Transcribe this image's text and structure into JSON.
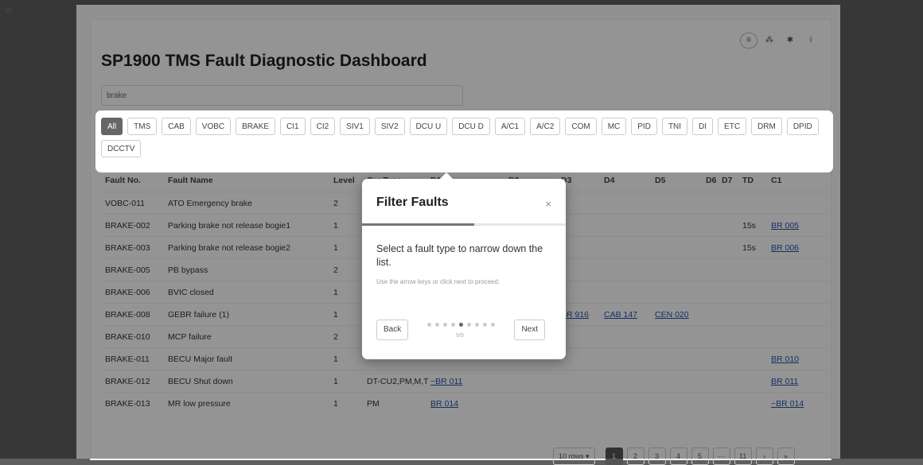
{
  "app": {
    "title": "SP1900 TMS Fault Diagnostic Dashboard",
    "search_value": "brake"
  },
  "toolbar_icons": [
    {
      "name": "list-view-icon",
      "glyph": "≡"
    },
    {
      "name": "hierarchy-icon",
      "glyph": "⁂"
    },
    {
      "name": "settings-icon",
      "glyph": "✱"
    },
    {
      "name": "info-icon",
      "glyph": "i"
    }
  ],
  "filters": [
    "All",
    "TMS",
    "CAB",
    "VOBC",
    "BRAKE",
    "CI1",
    "CI2",
    "SIV1",
    "SIV2",
    "DCU U",
    "DCU D",
    "A/C1",
    "A/C2",
    "COM",
    "MC",
    "PID",
    "TNI",
    "DI",
    "ETC",
    "DRM",
    "DPID",
    "DCCTV"
  ],
  "active_filter": "All",
  "table": {
    "headers": {
      "no": "Fault No.",
      "name": "Fault Name",
      "level": "Level",
      "car": "Car Type",
      "d1": "D1",
      "d2": "D2",
      "d3": "D3",
      "d4": "D4",
      "d5": "D5",
      "d6": "D6",
      "d7": "D7",
      "td": "TD",
      "c1": "C1"
    },
    "rows": [
      {
        "no": "VOBC-011",
        "name": "ATO Emergency brake",
        "level": "2",
        "car": "",
        "d1": "",
        "d2": "",
        "d3": "",
        "d4": "",
        "d5": "",
        "td": "",
        "c1": ""
      },
      {
        "no": "BRAKE-002",
        "name": "Parking brake not release bogie1",
        "level": "1",
        "car": "",
        "d1": "",
        "d2": "",
        "d3": "",
        "d4": "",
        "d5": "",
        "td": "15s",
        "c1": "BR 005"
      },
      {
        "no": "BRAKE-003",
        "name": "Parking brake not release bogie2",
        "level": "1",
        "car": "",
        "d1": "",
        "d2": "",
        "d3": "",
        "d4": "",
        "d5": "",
        "td": "15s",
        "c1": "BR 006"
      },
      {
        "no": "BRAKE-005",
        "name": "PB bypass",
        "level": "2",
        "car": "",
        "d1": "",
        "d2": "",
        "d3": "",
        "d4": "",
        "d5": "",
        "td": "",
        "c1": ""
      },
      {
        "no": "BRAKE-006",
        "name": "BVIC closed",
        "level": "1",
        "car": "",
        "d1": "",
        "d2": "",
        "d3": "",
        "d4": "",
        "d5": "",
        "td": "",
        "c1": ""
      },
      {
        "no": "BRAKE-008",
        "name": "GEBR failure (1)",
        "level": "1",
        "car": "",
        "d1": "",
        "d2": "",
        "d3": "BR 916",
        "d4": "CAB 147",
        "d5": "CEN 020",
        "td": "",
        "c1": ""
      },
      {
        "no": "BRAKE-010",
        "name": "MCP failure",
        "level": "2",
        "car": "",
        "d1": "",
        "d2": "",
        "d3": "",
        "d4": "",
        "d5": "",
        "td": "",
        "c1": ""
      },
      {
        "no": "BRAKE-011",
        "name": "BECU Major fault",
        "level": "1",
        "car": "",
        "d1": "",
        "d2": "",
        "d3": "",
        "d4": "",
        "d5": "",
        "td": "",
        "c1": "BR 010"
      },
      {
        "no": "BRAKE-012",
        "name": "BECU Shut down",
        "level": "1",
        "car": "DT-CU2,PM,M,T",
        "d1": "~BR 011",
        "d2": "",
        "d3": "",
        "d4": "",
        "d5": "",
        "td": "",
        "c1": "BR 011"
      },
      {
        "no": "BRAKE-013",
        "name": "MR low pressure",
        "level": "1",
        "car": "PM",
        "d1": "BR 014",
        "d2": "",
        "d3": "",
        "d4": "",
        "d5": "",
        "td": "",
        "c1": "~BR 014"
      }
    ]
  },
  "pagination": {
    "rows_label": "10 rows ▾",
    "pages": [
      "1",
      "2",
      "3",
      "4",
      "5",
      "···",
      "11",
      "›",
      "»"
    ],
    "active_page": "1"
  },
  "tour": {
    "title": "Filter Faults",
    "close": "×",
    "text": "Select a fault type to narrow down the list.",
    "hint": "Use the arrow keys or click next to proceed.",
    "back": "Back",
    "next": "Next",
    "counter": "5/9",
    "step": 5,
    "total": 9,
    "progress": 0.55
  }
}
